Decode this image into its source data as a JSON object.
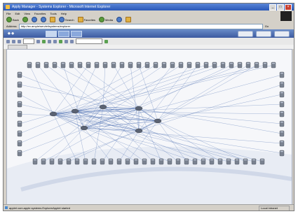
{
  "window": {
    "title": "Apply Manager - Systems Explorer - Microsoft Internet Explorer"
  },
  "menu": [
    "File",
    "Edit",
    "View",
    "Favorites",
    "Tools",
    "Help"
  ],
  "toolbar": {
    "back": "Back",
    "search": "Search",
    "favorites": "Favorites",
    "media": "Media"
  },
  "address": {
    "label": "Address",
    "url": "http://ex.ample/servlet/systems/explorer",
    "go": "Go"
  },
  "status": {
    "text": "applet com.apple.systems.ExplorerApplet started",
    "zone": "Local intranet"
  },
  "colors": {
    "accent": "#3c5aa0",
    "link": "#5a7ab8",
    "node": "#7a8290"
  }
}
